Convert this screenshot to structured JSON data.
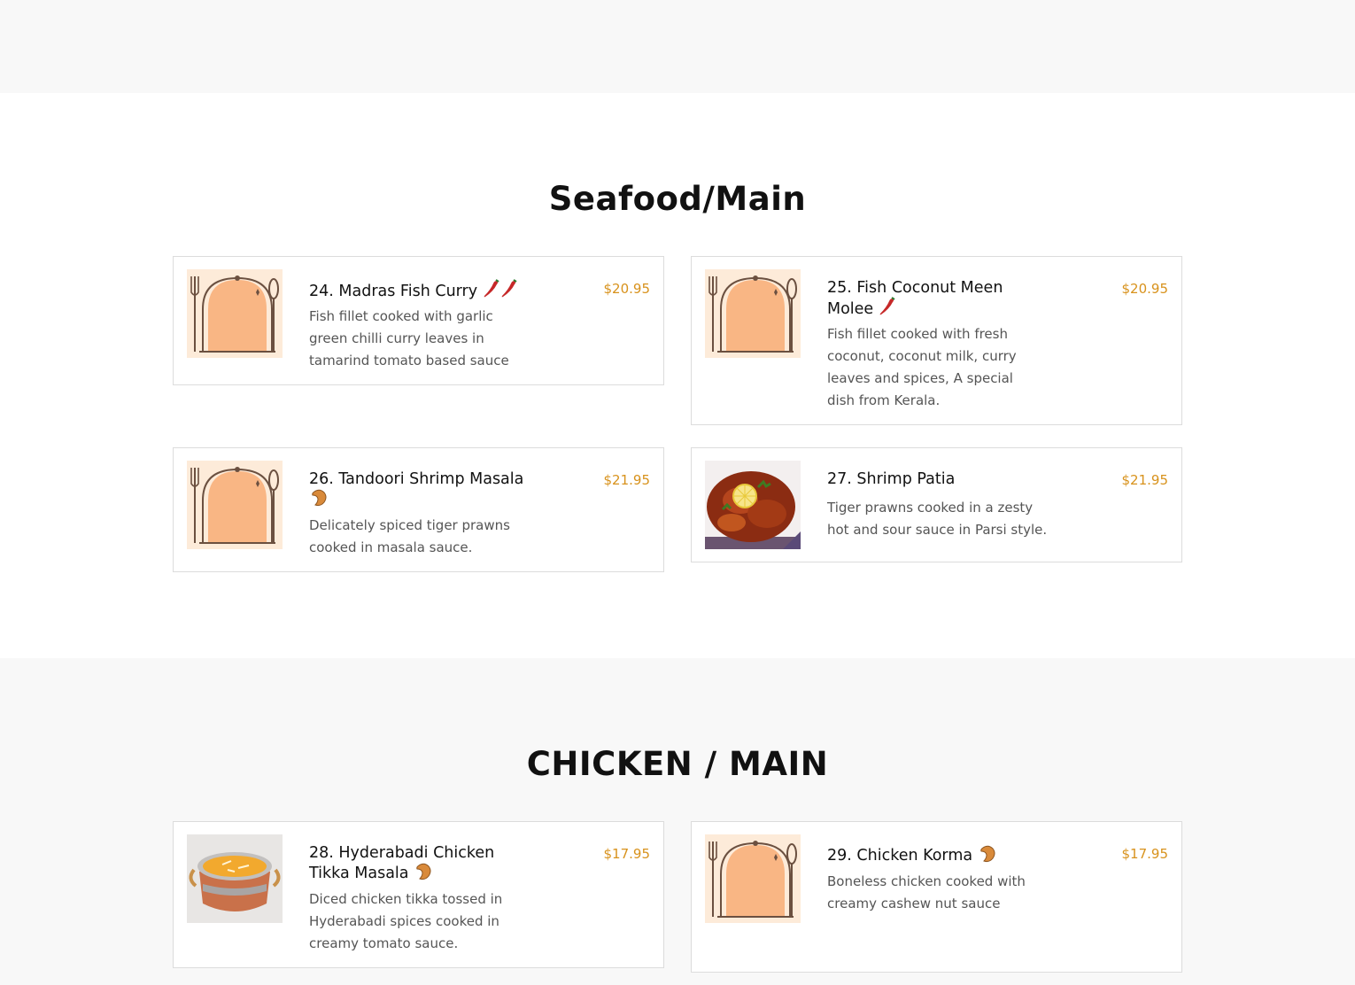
{
  "sections": [
    {
      "title": "Seafood/Main",
      "items": [
        {
          "name": "24. Madras Fish Curry",
          "price": "$20.95",
          "desc": "Fish fillet cooked with garlic green chilli curry leaves in tamarind tomato based sauce",
          "badges": [
            "chili-icon",
            "chili-icon"
          ],
          "image": "placeholder-dish-icon"
        },
        {
          "name": "25. Fish Coconut Meen Molee",
          "price": "$20.95",
          "desc": "Fish fillet cooked with fresh coconut, coconut milk, curry leaves and spices, A special dish from Kerala.",
          "badges": [
            "chili-icon"
          ],
          "image": "placeholder-dish-icon"
        },
        {
          "name": "26. Tandoori Shrimp Masala",
          "price": "$21.95",
          "desc": "Delicately spiced tiger prawns cooked in masala sauce.",
          "badges": [
            "cashew-icon"
          ],
          "image": "placeholder-dish-icon"
        },
        {
          "name": "27. Shrimp Patia",
          "price": "$21.95",
          "desc": "Tiger prawns cooked in a zesty hot and sour sauce in Parsi style.",
          "badges": [],
          "image": "shrimp-photo"
        }
      ]
    },
    {
      "title": "CHICKEN / MAIN",
      "items": [
        {
          "name": "28. Hyderabadi Chicken Tikka Masala",
          "price": "$17.95",
          "desc": "Diced chicken tikka tossed in Hyderabadi spices cooked in creamy tomato sauce.",
          "badges": [
            "cashew-icon"
          ],
          "image": "curry-pot-photo"
        },
        {
          "name": "29. Chicken Korma",
          "price": "$17.95",
          "desc": "Boneless chicken cooked with creamy cashew nut sauce",
          "badges": [
            "cashew-icon"
          ],
          "image": "placeholder-dish-icon"
        }
      ]
    }
  ],
  "colors": {
    "price": "#d8921c",
    "band": "#f8f8f8",
    "placeholder_bg": "#fdebd9",
    "dome": "#f9b684"
  }
}
